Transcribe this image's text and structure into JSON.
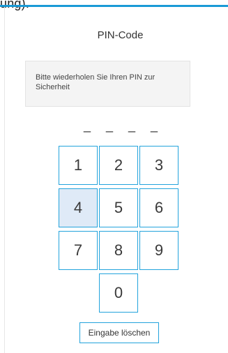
{
  "header": {
    "fragment_text": "ung)."
  },
  "pin": {
    "title": "PIN-Code",
    "instruction": "Bitte wiederholen Sie Ihren PIN zur Sicherheit",
    "placeholders": [
      "_",
      "_",
      "_",
      "_"
    ]
  },
  "keypad": {
    "keys": [
      "1",
      "2",
      "3",
      "4",
      "5",
      "6",
      "7",
      "8",
      "9",
      "0"
    ],
    "active_key": "4"
  },
  "actions": {
    "clear_label": "Eingabe löschen"
  },
  "colors": {
    "accent": "#1a9ad6",
    "key_border": "#22a3dc",
    "key_active_bg": "#dfeaf7"
  }
}
